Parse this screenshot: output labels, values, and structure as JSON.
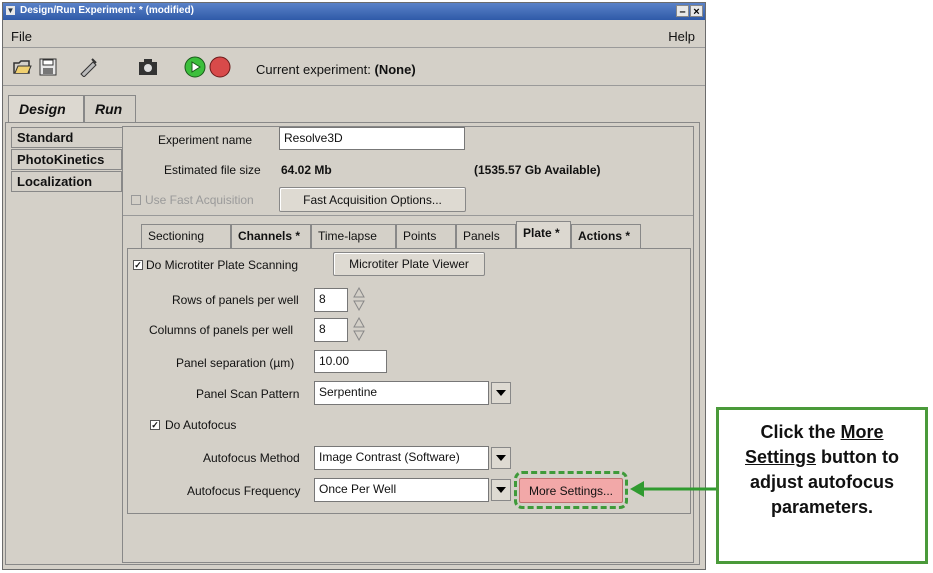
{
  "window": {
    "title": "Design/Run Experiment:  * (modified)"
  },
  "menu": {
    "file": "File",
    "help": "Help"
  },
  "toolbar": {
    "icons": [
      "open-folder-icon",
      "save-disk-icon",
      "edit-wand-icon",
      "camera-icon",
      "play-icon",
      "record-icon"
    ],
    "current_experiment_label": "Current experiment:",
    "current_experiment_value": "(None)"
  },
  "main_tabs": [
    {
      "label": "Design",
      "selected": true
    },
    {
      "label": "Run",
      "selected": false
    }
  ],
  "side_tabs": [
    "Standard",
    "PhotoKinetics",
    "Localization"
  ],
  "design": {
    "experiment_name_label": "Experiment name",
    "experiment_name_value": "Resolve3D",
    "estimated_file_size_label": "Estimated file size",
    "estimated_file_size_value": "64.02 Mb",
    "available_value": "(1535.57 Gb Available)",
    "use_fast_acquisition_label": "Use Fast Acquisition",
    "fast_acquisition_options_label": "Fast Acquisition Options..."
  },
  "sub_tabs": [
    {
      "label": "Sectioning",
      "bold": false
    },
    {
      "label": "Channels *",
      "bold": true
    },
    {
      "label": "Time-lapse",
      "bold": false
    },
    {
      "label": "Points",
      "bold": false
    },
    {
      "label": "Panels",
      "bold": false
    },
    {
      "label": "Plate *",
      "bold": true,
      "selected": true
    },
    {
      "label": "Actions *",
      "bold": true
    }
  ],
  "plate": {
    "do_microtiter_label": "Do Microtiter Plate Scanning",
    "do_microtiter_checked": true,
    "plate_viewer_label": "Microtiter Plate Viewer",
    "rows_label": "Rows of panels per well",
    "rows_value": "8",
    "columns_label": "Columns of panels per well",
    "columns_value": "8",
    "separation_label": "Panel separation (µm)",
    "separation_value": "10.00",
    "scan_pattern_label": "Panel Scan Pattern",
    "scan_pattern_value": "Serpentine",
    "do_autofocus_label": "Do Autofocus",
    "do_autofocus_checked": true,
    "autofocus_method_label": "Autofocus Method",
    "autofocus_method_value": "Image Contrast (Software)",
    "autofocus_frequency_label": "Autofocus Frequency",
    "autofocus_frequency_value": "Once Per Well",
    "more_settings_label": "More Settings..."
  },
  "callout": {
    "line1": "Click the ",
    "link1": "More",
    "link2": "Settings",
    "line2": " button to",
    "line3": "adjust autofocus",
    "line4": "parameters."
  },
  "colors": {
    "highlight_button": "#f2a8a8",
    "highlight_border": "#3f9a3a",
    "arrow": "#2f9a2f"
  }
}
